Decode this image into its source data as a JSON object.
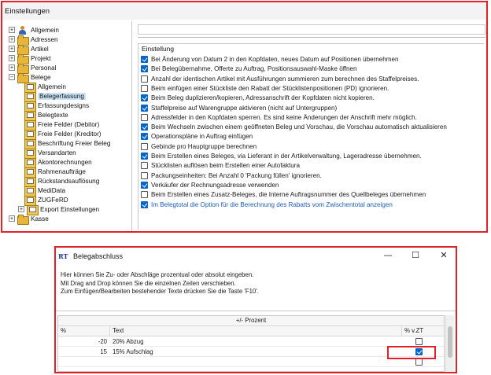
{
  "settings_window": {
    "title": "Einstellungen",
    "tree": [
      {
        "label": "Allgemein",
        "icon": "settings-person-icon",
        "expander": "+"
      },
      {
        "label": "Adressen",
        "icon": "folder-icon",
        "expander": "+"
      },
      {
        "label": "Artikel",
        "icon": "folder-icon",
        "expander": "+"
      },
      {
        "label": "Projekt",
        "icon": "folder-icon",
        "expander": "+"
      },
      {
        "label": "Personal",
        "icon": "folder-icon",
        "expander": "+"
      },
      {
        "label": "Belege",
        "icon": "folder-icon",
        "expander": "−"
      },
      {
        "label": "Allgemein",
        "icon": "document-settings-icon"
      },
      {
        "label": "Belegerfassung",
        "icon": "document-settings-icon",
        "selected": true
      },
      {
        "label": "Erfassungdesigns",
        "icon": "document-settings-icon"
      },
      {
        "label": "Belegtexte",
        "icon": "document-settings-icon"
      },
      {
        "label": "Freie Felder (Debitor)",
        "icon": "document-settings-icon"
      },
      {
        "label": "Freie Felder (Kreditor)",
        "icon": "document-settings-icon"
      },
      {
        "label": "Beschriftung Freier Beleg",
        "icon": "document-settings-icon"
      },
      {
        "label": "Versandarten",
        "icon": "document-settings-icon"
      },
      {
        "label": "Akontorechnungen",
        "icon": "document-settings-icon"
      },
      {
        "label": "Rahmenaufträge",
        "icon": "document-settings-icon"
      },
      {
        "label": "Rückstandsauflösung",
        "icon": "document-settings-icon"
      },
      {
        "label": "MediData",
        "icon": "document-settings-icon"
      },
      {
        "label": "ZUGFeRD",
        "icon": "document-settings-icon"
      },
      {
        "label": "Export Einstellungen",
        "icon": "document-settings-icon",
        "expander": "+"
      },
      {
        "label": "Kasse",
        "icon": "folder-icon",
        "expander": "+"
      }
    ],
    "group_title": "Einstellung",
    "options": [
      {
        "label": "Bei Änderung von Datum 2 in den Kopfdaten, neues Datum auf Positionen übernehmen",
        "checked": true
      },
      {
        "label": "Bei Belegübernahme, Offerte zu Auftrag, Positionsauswahl-Maske öffnen",
        "checked": true
      },
      {
        "label": "Anzahl der identischen Artikel mit Ausführungen summieren zum berechnen des Staffelpreises.",
        "checked": false
      },
      {
        "label": "Beim einfügen einer Stückliste den Rabatt der Stücklistenpositionen (PD) ignorieren.",
        "checked": false
      },
      {
        "label": "Beim Beleg duplizieren/kopieren, Adressanschrift der Kopfdaten nicht kopieren.",
        "checked": true
      },
      {
        "label": "Staffelpreise auf Warengruppe aktivieren (nicht auf Untergruppen)",
        "checked": true
      },
      {
        "label": "Adressfelder in den Kopfdaten sperren. Es sind keine Änderungen der Anschrift mehr möglich.",
        "checked": false
      },
      {
        "label": "Beim Wechseln zwischen einem geöffneten Beleg und Vorschau, die Vorschau automatisch aktualisieren",
        "checked": true
      },
      {
        "label": "Operationspläne in Auftrag einfügen",
        "checked": true
      },
      {
        "label": "Gebinde pro Hauptgruppe berechnen",
        "checked": false
      },
      {
        "label": "Beim Erstellen eines Beleges, via Lieferant in der Artikelverwaltung, Lageradresse übernehmen.",
        "checked": true
      },
      {
        "label": "Stücklisten auflösen beim Erstellen einer Autofaktura",
        "checked": false
      },
      {
        "label": "Packungseinheiten: Bei Anzahl 0 'Packung füllen' ignorieren.",
        "checked": false
      },
      {
        "label": "Verkäufer der Rechnungsadresse verwenden",
        "checked": true
      },
      {
        "label": "Beim Erstellen eines Zusatz-Beleges, die Interne Auftragsnummer des Quellbeleges übernehmen",
        "checked": false
      },
      {
        "label": "Im Belegtotal die Option für die Berechnung des Rabatts vom Zwischentotal anzeigen",
        "checked": true,
        "highlight": true
      }
    ]
  },
  "dialog": {
    "logo": "RT",
    "title": "Belegabschluss",
    "minimize": "—",
    "maximize": "☐",
    "close": "✕",
    "info_lines": [
      "Hier können Sie Zu- oder Abschläge prozentual oder absolut eingeben.",
      "Mit Drag and Drop können Sie die einzelnen Zeilen verschieben.",
      "Zum Einfügen/Bearbeiten bestehender Texte drücken Sie die Taste 'F10'."
    ],
    "group_header": "+/- Prozent",
    "columns": {
      "percent": "%",
      "text": "Text",
      "vzt": "% v.ZT"
    },
    "rows": [
      {
        "percent": "-20",
        "text": "20% Abzug",
        "vzt": false
      },
      {
        "percent": "15",
        "text": "15% Aufschlag",
        "vzt": true
      },
      {
        "percent": "",
        "text": "",
        "vzt": false
      }
    ]
  },
  "colors": {
    "accent": "#0064c8",
    "highlight_frame": "#e0202a",
    "link_text": "#1a5fbf"
  }
}
